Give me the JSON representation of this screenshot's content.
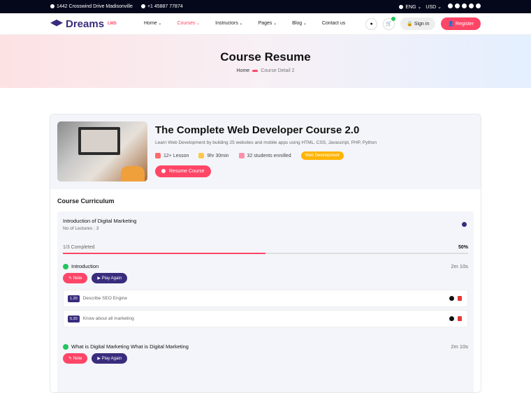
{
  "topbar": {
    "address": "1442 Crosswind Drive Madisonville",
    "phone": "+1 45887 77874",
    "language": "ENG",
    "currency": "USD"
  },
  "nav": {
    "logo": "Dreams",
    "logo_sup": "LMS",
    "menu": [
      "Home",
      "Courses",
      "Instructors",
      "Pages",
      "Blog",
      "Contact us"
    ],
    "cart_count": "",
    "signin": "Sign in",
    "register": "Register"
  },
  "hero": {
    "title": "Course Resume",
    "crumb_home": "Home",
    "crumb_current": "Course Detail 2"
  },
  "course": {
    "title": "The Complete Web Developer Course 2.0",
    "description": "Learn Web Development by building 25 websites and mobile apps using HTML, CSS, Javascript, PHP, Python",
    "lessons": "12+ Lesson",
    "duration": "9hr 30min",
    "students": "32 students enrolled",
    "tag": "Web Development",
    "resume": "Resume Course",
    "tag_color": "#ffb400"
  },
  "curriculum": {
    "title": "Course Curriculum",
    "section_title": "Introduction of Digital Marketing",
    "section_sub": "No of Lectures : 3",
    "progress_label": "1/3  Completed",
    "progress_pct": "50%",
    "progress_value": 0.5,
    "lessons": [
      {
        "name": "Introduction",
        "time": "2m 10s",
        "note": "Note",
        "play": "Play Again",
        "subs": [
          {
            "num": "1.20",
            "text": "Describe SEO Engine"
          },
          {
            "num": "5.20",
            "text": "Know about all marketing"
          }
        ]
      },
      {
        "name": "What is Digital Marketing What is Digital Marketing",
        "time": "2m 10s",
        "note": "Note",
        "play": "Play Again",
        "subs": []
      }
    ]
  },
  "colors": {
    "accent": "#ff4667",
    "primary": "#392c7d",
    "success": "#22c55e"
  }
}
